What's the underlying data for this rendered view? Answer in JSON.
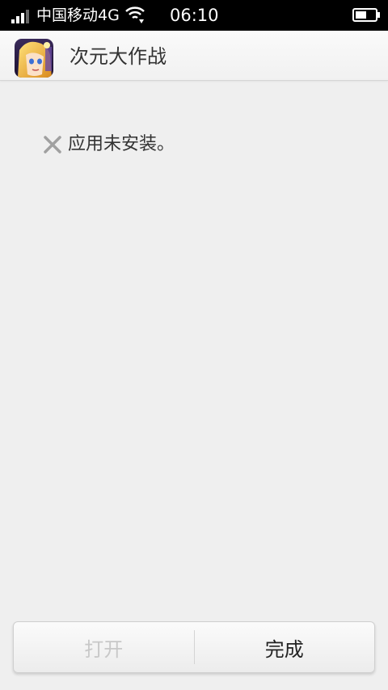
{
  "status_bar": {
    "carrier": "中国移动4G",
    "time": "06:10"
  },
  "app": {
    "title": "次元大作战"
  },
  "message": {
    "text": "应用未安装。"
  },
  "buttons": {
    "open_label": "打开",
    "done_label": "完成"
  }
}
